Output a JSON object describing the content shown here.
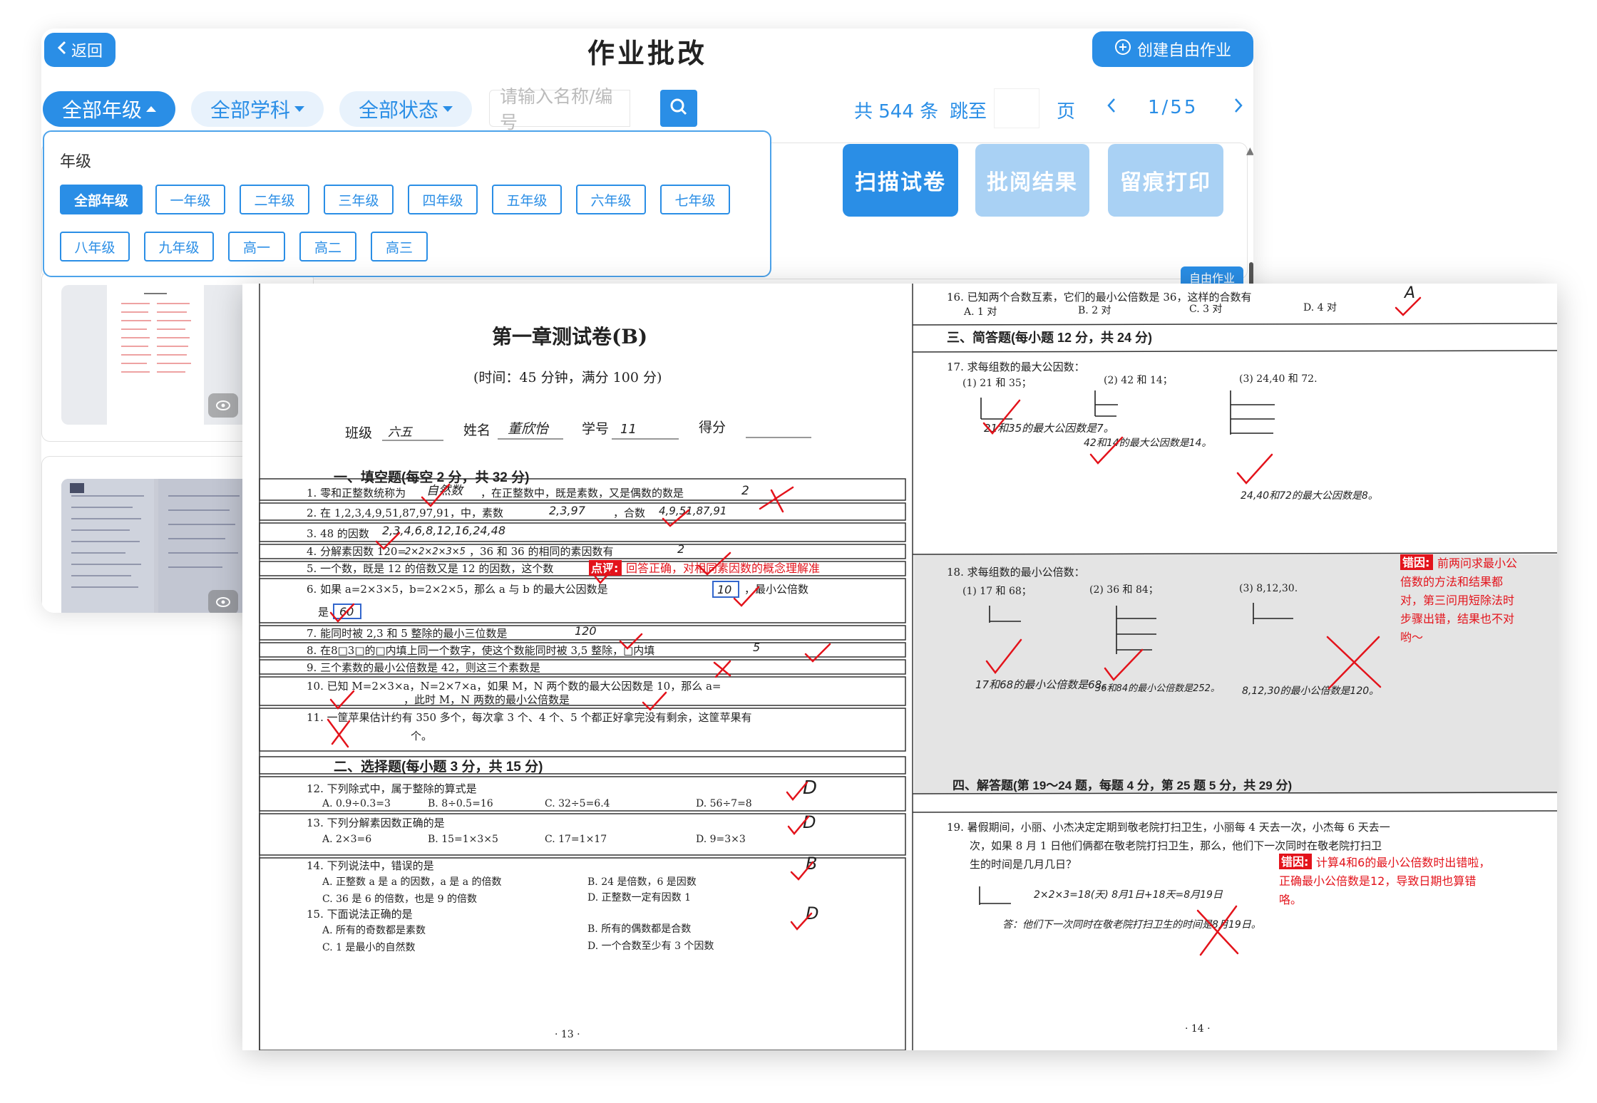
{
  "header": {
    "back_label": "返回",
    "title": "作业批改",
    "create_label": "创建自由作业"
  },
  "filters": {
    "grade": "全部年级",
    "subject": "全部学科",
    "status": "全部状态"
  },
  "search": {
    "placeholder": "请输入名称/编号"
  },
  "pager": {
    "total": "共 544 条",
    "jump_label": "跳至",
    "page_unit": "页",
    "current": "1/55"
  },
  "tools": {
    "scan": "扫描试卷",
    "results": "批阅结果",
    "print": "留痕打印"
  },
  "badge": "自由作业",
  "grade_dropdown": {
    "title": "年级",
    "options": [
      "全部年级",
      "一年级",
      "二年级",
      "三年级",
      "四年级",
      "五年级",
      "六年级",
      "七年级",
      "八年级",
      "九年级",
      "高一",
      "高二",
      "高三"
    ],
    "selected": "全部年级"
  },
  "colors": {
    "accent": "#2a8ee6",
    "accent_light": "#a9d1f4",
    "mark_red": "#e3131b"
  },
  "icons": [
    "chevron-left-icon",
    "plus-circle-icon",
    "caret-up-icon",
    "caret-down-icon",
    "search-icon",
    "chevron-left-icon",
    "chevron-right-icon",
    "eye-icon",
    "scroll-up-icon"
  ],
  "exam": {
    "title": "第一章测试卷(B)",
    "subtitle": "(时间：45 分钟，满分 100 分)",
    "info": {
      "class_label": "班级",
      "class_value": "六五",
      "name_label": "姓名",
      "name_value": "董欣怡",
      "id_label": "学号",
      "id_value": "11",
      "score_label": "得分"
    },
    "left": {
      "section1": "一、填空题(每空 2 分，共 32 分)",
      "q1": "1. 零和正整数统称为",
      "q1a": "自然数",
      "q1b": "，在正整数中，既是素数，又是偶数的数是",
      "q1c": "2",
      "q2": "2. 在 1,2,3,4,9,51,87,97,91，中，素数",
      "q2a": "2,3,97",
      "q2b": "，合数",
      "q2c": "4,9,51,87,91",
      "q3": "3. 48 的因数",
      "q3a": "2,3,4,6,8,12,16,24,48",
      "q4": "4. 分解素因数 120=",
      "q4a": "2×2×2×3×5",
      "q4b": "，36 和 36 的相同的素因数有",
      "q4c": "2",
      "q5": "5. 一个数，既是 12 的倍数又是 12 的因数，这个数",
      "q6": "6. 如果 a=2×3×5，b=2×2×5，那么 a 与 b 的最大公因数是",
      "q6a": "10",
      "q6b": "，最小公倍数",
      "q6c": "是",
      "q6d": "60",
      "q7": "7. 能同时被 2,3 和 5 整除的最小三位数是",
      "q7a": "120",
      "q8": "8. 在8□3□的□内填上同一个数字，使这个数能同时被 3,5 整除，□内填",
      "q8a": "5",
      "q9": "9. 三个素数的最小公倍数是 42，则这三个素数是",
      "q10": "10. 已知 M=2×3×a，N=2×7×a，如果 M，N 两个数的最大公因数是 10，那么 a=",
      "q10b": "，此时 M，N 两数的最小公倍数是",
      "q11": "11. 一筐苹果估计约有 350 多个，每次拿 3 个、4 个、5 个都正好拿完没有剩余，这筐苹果有",
      "q11b": "个。",
      "section2": "二、选择题(每小题 3 分，共 15 分)",
      "q12": "12. 下列除式中，属于整除的算式是",
      "q12o": [
        "A. 0.9÷0.3=3",
        "B. 8÷0.5=16",
        "C. 32÷5=6.4",
        "D. 56÷7=8"
      ],
      "q12a": "D",
      "q13": "13. 下列分解素因数正确的是",
      "q13o": [
        "A. 2×3=6",
        "B. 15=1×3×5",
        "C. 17=1×17",
        "D. 9=3×3"
      ],
      "q13a": "D",
      "q14": "14. 下列说法中，错误的是",
      "q14o": [
        "A. 正整数 a 是 a 的因数，a 是 a 的倍数",
        "B. 24 是倍数，6 是因数",
        "C. 36 是 6 的倍数，也是 9 的倍数",
        "D. 正整数一定有因数 1"
      ],
      "q14a": "B",
      "q15": "15. 下面说法正确的是",
      "q15o": [
        "A. 所有的奇数都是素数",
        "B. 所有的偶数都是合数",
        "C. 1 是最小的自然数",
        "D. 一个合数至少有 3 个因数"
      ],
      "q15a": "D",
      "page": "· 13 ·",
      "comment_tag": "点评:",
      "comment_text": "回答正确，对相同素因数的概念理解准"
    },
    "right": {
      "q16": "16. 已知两个合数互素，它们的最小公倍数是 36，这样的合数有",
      "q16o": [
        "A. 1 对",
        "B. 2 对",
        "C. 3 对",
        "D. 4 对"
      ],
      "q16a": "A",
      "section3": "三、简答题(每小题 12 分，共 24 分)",
      "q17": "17. 求每组数的最大公因数：",
      "q17o": [
        "(1) 21 和 35；",
        "(2) 42 和 14；",
        "(3) 24,40 和 72."
      ],
      "q17w1": "21和35的最大公因数是7。",
      "q17w2": "42和14的最大公因数是14。",
      "q17w3": "24,40和72的最大公因数是8。",
      "q18": "18. 求每组数的最小公倍数：",
      "q18o": [
        "(1) 17 和 68；",
        "(2) 36 和 84；",
        "(3) 8,12,30."
      ],
      "q18w1": "17和68的最小公倍数是68。",
      "q18w2": "36和84的最小公倍数是252。",
      "q18w3": "8,12,30的最小公倍数是120。",
      "err1_tag": "错因:",
      "err1_text": [
        "前两问求最小公",
        "倍数的方法和结果都",
        "对，第三问用短除法时",
        "步骤出错，结果也不对",
        "哟～"
      ],
      "section4": "四、解答题(第 19～24 题，每题 4 分，第 25 题 5 分，共 29 分)",
      "q19": [
        "19. 暑假期间，小丽、小杰决定定期到敬老院打扫卫生，小丽每 4 天去一次，小杰每 6 天去一",
        "次，如果 8 月 1 日他们俩都在敬老院打扫卫生，那么，他们下一次同时在敬老院打扫卫",
        "生的时间是几月几日？"
      ],
      "q19w1": "2×2×3=18(天)  8月1日+18天=8月19日",
      "q19w2": "答：他们下一次同时在敬老院打扫卫生的时间是8月19日。",
      "err2_tag": "错因:",
      "err2_text": [
        "计算4和6的最小公倍数时出错啦，",
        "正确最小公倍数是12，导致日期也算错",
        "咯。"
      ],
      "page": "· 14 ·"
    }
  }
}
